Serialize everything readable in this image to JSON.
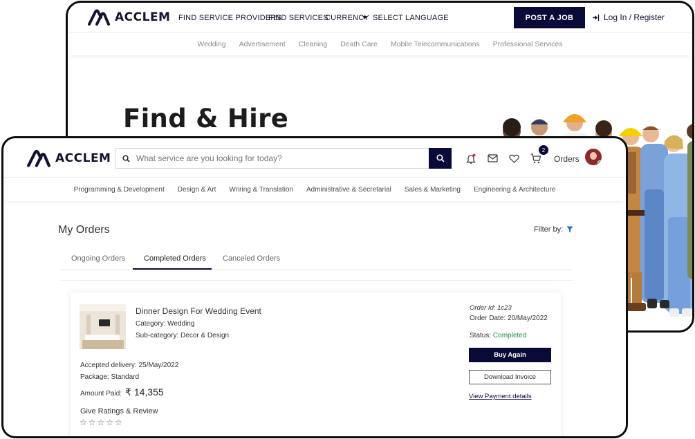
{
  "brand": {
    "name": "ACCLEM",
    "accent": "#0a0a38"
  },
  "landing": {
    "nav": [
      "FIND SERVICE PROVIDERS",
      "FIND SERVICES",
      "CURRENCY",
      "SELECT LANGUAGE"
    ],
    "post_job": "POST A JOB",
    "login": "Log In / Register",
    "categories": [
      "Wedding",
      "Advertisement",
      "Cleaning",
      "Death Care",
      "Mobile Telecommunications",
      "Professional Services"
    ],
    "hero_title": "Find & Hire"
  },
  "app": {
    "search_placeholder": "What service are you looking for today?",
    "cart_count": "2",
    "orders_link": "Orders",
    "categories": [
      "Programming & Development",
      "Design & Art",
      "Wriring & Translation",
      "Administrative & Secretarial",
      "Sales & Marketing",
      "Engineering & Architecture"
    ],
    "page_title": "My Orders",
    "filter_label": "Filter by:",
    "tabs": [
      "Ongoing Orders",
      "Completed Orders",
      "Canceled Orders"
    ],
    "active_tab": "Completed Orders",
    "order": {
      "title": "Dinner Design For Wedding Event",
      "category": "Category: Wedding",
      "subcategory": "Sub-category: Decor & Design",
      "accepted_delivery": "Accepted delivery: 25/May/2022",
      "package": "Package: Standard",
      "amount_label": "Amount Paid:",
      "amount": "₹ 14,355",
      "ratings_label": "Give Ratings & Review",
      "order_id": "Order Id: 1c23",
      "order_date": "Order Date: 20/May/2022",
      "status_label": "Status:",
      "status": "Completed",
      "buy_again": "Buy Again",
      "download_invoice": "Download Invoice",
      "payment_details": "View Payment details"
    }
  }
}
